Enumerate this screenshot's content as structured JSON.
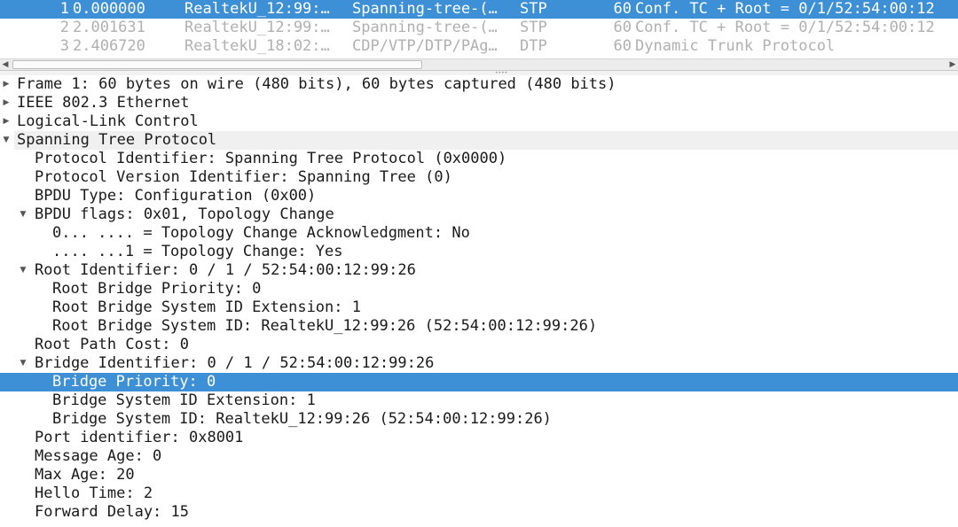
{
  "packet_list": {
    "rows": [
      {
        "no": "1",
        "time": "0.000000",
        "source": "RealtekU_12:99:…",
        "destination": "Spanning-tree-(…",
        "protocol": "STP",
        "length": "60",
        "info": "Conf. TC + Root = 0/1/52:54:00:12"
      },
      {
        "no": "2",
        "time": "2.001631",
        "source": "RealtekU_12:99:…",
        "destination": "Spanning-tree-(…",
        "protocol": "STP",
        "length": "60",
        "info": "Conf. TC + Root = 0/1/52:54:00:12"
      },
      {
        "no": "3",
        "time": "2.406720",
        "source": "RealtekU_18:02:…",
        "destination": "CDP/VTP/DTP/PAg…",
        "protocol": "DTP",
        "length": "60",
        "info": "Dynamic Trunk Protocol"
      }
    ]
  },
  "details": {
    "frame": "Frame 1: 60 bytes on wire (480 bits), 60 bytes captured (480 bits)",
    "ethernet": "IEEE 802.3 Ethernet",
    "llc": "Logical-Link Control",
    "stp": "Spanning Tree Protocol",
    "protocol_identifier": "Protocol Identifier: Spanning Tree Protocol (0x0000)",
    "protocol_version": "Protocol Version Identifier: Spanning Tree (0)",
    "bpdu_type": "BPDU Type: Configuration (0x00)",
    "bpdu_flags": "BPDU flags: 0x01, Topology Change",
    "flag_tc_ack": "0... .... = Topology Change Acknowledgment: No",
    "flag_tc": ".... ...1 = Topology Change: Yes",
    "root_identifier": "Root Identifier: 0 / 1 / 52:54:00:12:99:26",
    "root_bridge_priority": "Root Bridge Priority: 0",
    "root_bridge_sysid_ext": "Root Bridge System ID Extension: 1",
    "root_bridge_sysid": "Root Bridge System ID: RealtekU_12:99:26 (52:54:00:12:99:26)",
    "root_path_cost": "Root Path Cost: 0",
    "bridge_identifier": "Bridge Identifier: 0 / 1 / 52:54:00:12:99:26",
    "bridge_priority": "Bridge Priority: 0",
    "bridge_sysid_ext": "Bridge System ID Extension: 1",
    "bridge_sysid": "Bridge System ID: RealtekU_12:99:26 (52:54:00:12:99:26)",
    "port_identifier": "Port identifier: 0x8001",
    "message_age": "Message Age: 0",
    "max_age": "Max Age: 20",
    "hello_time": "Hello Time: 2",
    "forward_delay": "Forward Delay: 15"
  },
  "icons": {
    "collapsed": "triangle-right-icon",
    "expanded": "triangle-down-icon",
    "scroll_left": "scroll-left-arrow-icon",
    "scroll_right": "scroll-right-arrow-icon"
  },
  "colors": {
    "selection": "#3d8fd6",
    "dimmed_text": "#b0b0b0"
  }
}
